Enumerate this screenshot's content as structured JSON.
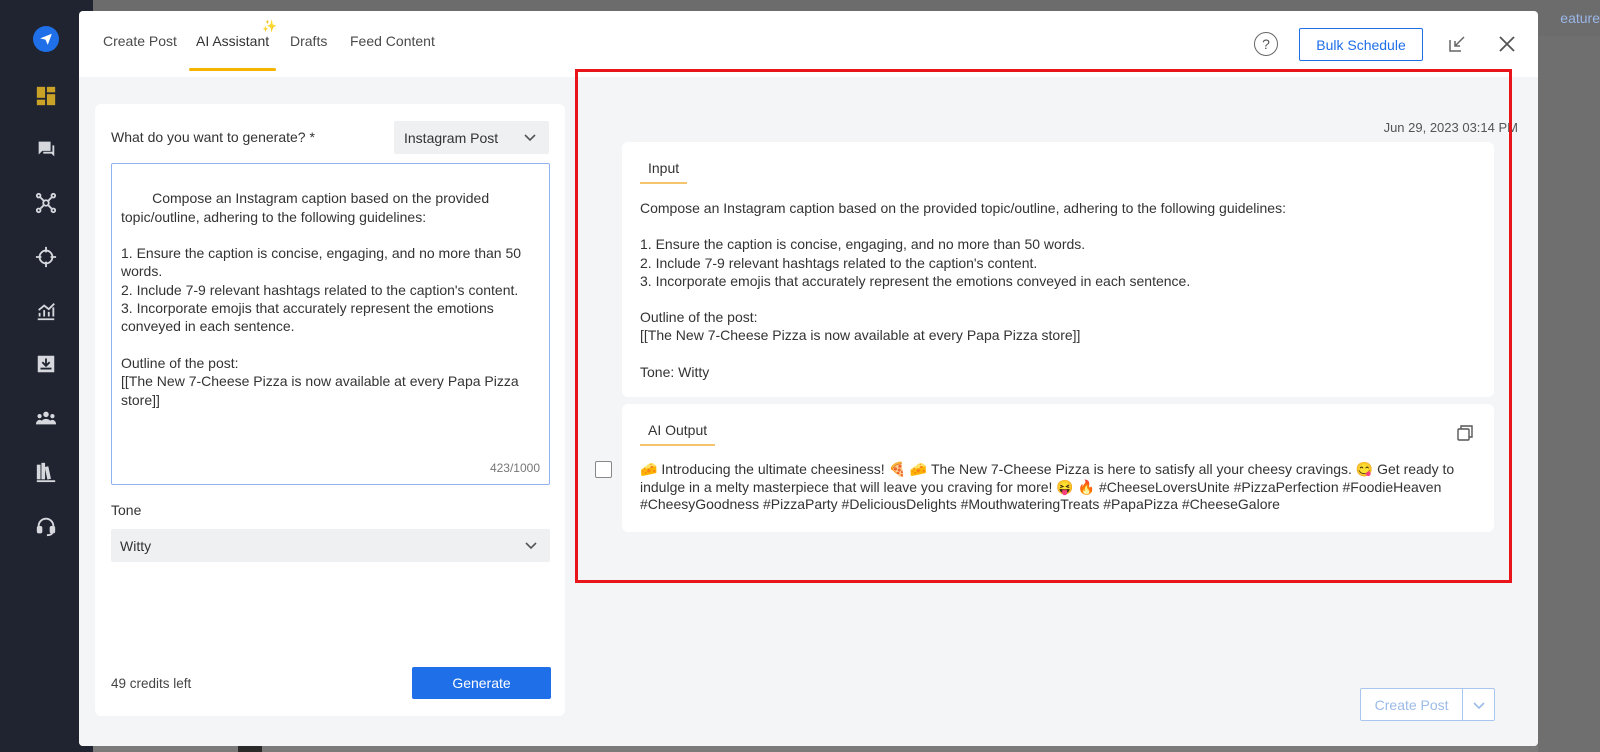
{
  "background": {
    "feature_link": "eature"
  },
  "tabs": [
    {
      "label": "Create Post"
    },
    {
      "label": "AI Assistant"
    },
    {
      "label": "Drafts"
    },
    {
      "label": "Feed Content"
    }
  ],
  "header": {
    "help_icon": "?",
    "bulk_schedule_label": "Bulk Schedule"
  },
  "form": {
    "generate_label": "What do you want to generate? *",
    "content_type": "Instagram Post",
    "prompt": "Compose an Instagram caption based on the provided topic/outline, adhering to the following guidelines:\n\n1. Ensure the caption is concise, engaging, and no more than 50 words.\n2. Include 7-9 relevant hashtags related to the caption's content.\n3. Incorporate emojis that accurately represent the emotions conveyed in each sentence.\n\nOutline of the post:\n[[The New 7-Cheese Pizza is now available at every Papa Pizza store]]",
    "char_count": "423/1000",
    "tone_label": "Tone",
    "tone_value": "Witty",
    "credits": "49 credits left",
    "generate_label_btn": "Generate"
  },
  "results": {
    "timestamp": "Jun 29, 2023 03:14 PM",
    "input_label": "Input",
    "input_text": "Compose an Instagram caption based on the provided topic/outline, adhering to the following guidelines:\n\n1. Ensure the caption is concise, engaging, and no more than 50 words.\n2. Include 7-9 relevant hashtags related to the caption's content.\n3. Incorporate emojis that accurately represent the emotions conveyed in each sentence.\n\nOutline of the post:\n[[The New 7-Cheese Pizza is now available at every Papa Pizza store]]\n\nTone: Witty",
    "output_label": "AI Output",
    "output_text": "🧀 Introducing the ultimate cheesiness! 🍕 🧀 The New 7-Cheese Pizza is here to satisfy all your cheesy cravings. 😋 Get ready to indulge in a melty masterpiece that will leave you craving for more! 😝 🔥 #CheeseLoversUnite #PizzaPerfection #FoodieHeaven #CheesyGoodness #PizzaParty #DeliciousDelights #MouthwateringTreats #PapaPizza #CheeseGalore"
  },
  "footer": {
    "create_post_label": "Create Post"
  },
  "colors": {
    "accent": "#1e6fe8",
    "tab_underline": "#f5b400",
    "highlight_frame": "#e8151b",
    "nav_bg": "#1f2430"
  },
  "nav_icons": [
    "send-icon",
    "dashboard-icon",
    "messages-icon",
    "network-icon",
    "target-icon",
    "analytics-icon",
    "inbox-icon",
    "team-icon",
    "library-icon",
    "support-icon"
  ]
}
